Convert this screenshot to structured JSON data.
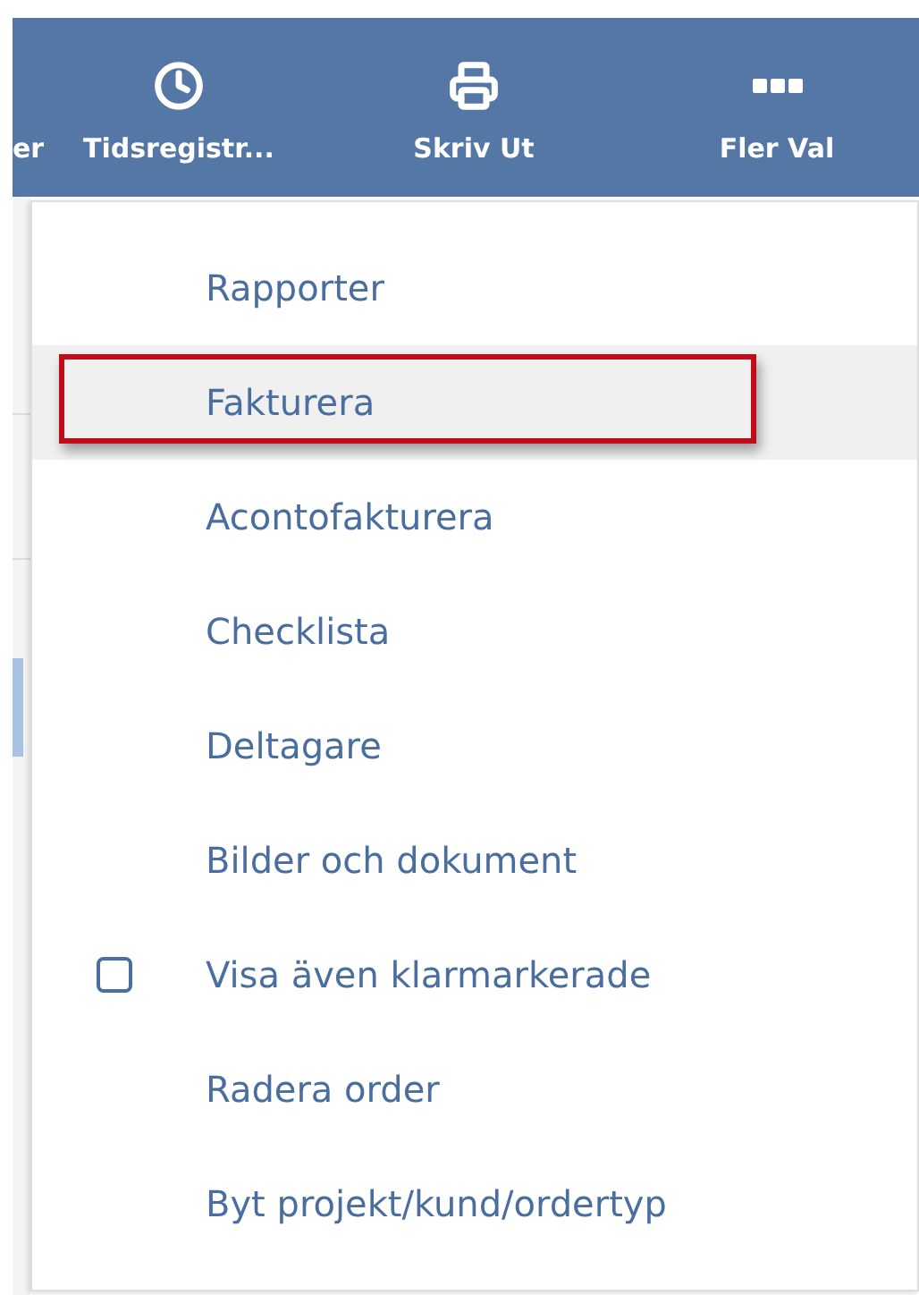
{
  "toolbar": {
    "items": [
      {
        "label": "er",
        "kind": "cut"
      },
      {
        "label": "Tidsregistr...",
        "kind": "time"
      },
      {
        "label": "Skriv Ut",
        "kind": "print"
      },
      {
        "label": "Fler Val",
        "kind": "more"
      }
    ]
  },
  "menu": {
    "items": [
      {
        "kind": "action",
        "label": "Rapporter",
        "selected": false,
        "marked": false
      },
      {
        "kind": "action",
        "label": "Fakturera",
        "selected": true,
        "marked": true
      },
      {
        "kind": "action",
        "label": "Acontofakturera",
        "selected": false,
        "marked": false
      },
      {
        "kind": "action",
        "label": "Checklista",
        "selected": false,
        "marked": false
      },
      {
        "kind": "action",
        "label": "Deltagare",
        "selected": false,
        "marked": false
      },
      {
        "kind": "action",
        "label": "Bilder och dokument",
        "selected": false,
        "marked": false
      },
      {
        "kind": "checkbox",
        "label": "Visa även klarmarkerade",
        "checked": false,
        "selected": false,
        "marked": false
      },
      {
        "kind": "action",
        "label": "Radera order",
        "selected": false,
        "marked": false
      },
      {
        "kind": "action",
        "label": "Byt projekt/kund/ordertyp",
        "selected": false,
        "marked": false
      }
    ]
  }
}
